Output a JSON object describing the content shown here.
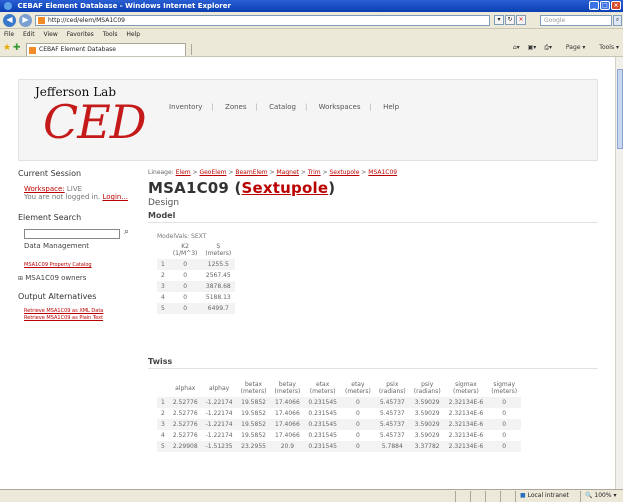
{
  "browser": {
    "title": "CEBAF Element Database - Windows Internet Explorer",
    "url": "http://ced/elem/MSA1C09",
    "search_placeholder": "Google",
    "menu": [
      "File",
      "Edit",
      "View",
      "Favorites",
      "Tools",
      "Help"
    ],
    "tab_title": "CEBAF Element Database",
    "cmd": {
      "page": "Page",
      "tools": "Tools"
    },
    "status_zone": "Local intranet",
    "zoom": "100%"
  },
  "logo": {
    "top": "Jefferson Lab",
    "main": "CED"
  },
  "nav": [
    "Inventory",
    "Zones",
    "Catalog",
    "Workspaces",
    "Help"
  ],
  "sidebar": {
    "session_heading": "Current Session",
    "workspace_label": "Workspace:",
    "workspace_value": "LIVE",
    "login_text": "You are not logged in.",
    "login_link": "Login...",
    "search_heading": "Element Search",
    "search_value": "",
    "data_mgmt": "Data Management",
    "catalog_link": "MSA1C09 Property Catalog",
    "owners": "MSA1C09 owners",
    "output_heading": "Output Alternatives",
    "xml_link": "Retrieve MSA1C09 as XML Data",
    "text_link": "Retrieve MSA1C09 as Plain Text"
  },
  "main": {
    "lineage_label": "Lineage:",
    "lineage": [
      "Elem",
      "GeoElem",
      "BeamElem",
      "Magnet",
      "Trim",
      "Sextupole",
      "MSA1C09"
    ],
    "element_name": "MSA1C09",
    "element_type": "Sextupole",
    "subtitle": "Design"
  },
  "model": {
    "heading": "Model",
    "modelvals_label": "ModelVals: SEXT",
    "columns": [
      "",
      "K2\n(1/M^3)",
      "S\n(meters)"
    ],
    "rows": [
      [
        "1",
        "0",
        "1255.5"
      ],
      [
        "2",
        "0",
        "2567.45"
      ],
      [
        "3",
        "0",
        "3878.68"
      ],
      [
        "4",
        "0",
        "5188.13"
      ],
      [
        "5",
        "0",
        "6499.7"
      ]
    ]
  },
  "twiss": {
    "heading": "Twiss",
    "columns": [
      "",
      "alphax",
      "alphay",
      "betax\n(meters)",
      "betay\n(meters)",
      "etax\n(meters)",
      "etay\n(meters)",
      "psix\n(radians)",
      "psiy\n(radians)",
      "sigmax\n(meters)",
      "sigmay\n(meters)"
    ],
    "rows": [
      [
        "1",
        "2.52776",
        "-1.22174",
        "19.5852",
        "17.4066",
        "0.231545",
        "0",
        "5.45737",
        "3.59029",
        "2.32134E-6",
        "0"
      ],
      [
        "2",
        "2.52776",
        "-1.22174",
        "19.5852",
        "17.4066",
        "0.231545",
        "0",
        "5.45737",
        "3.59029",
        "2.32134E-6",
        "0"
      ],
      [
        "3",
        "2.52776",
        "-1.22174",
        "19.5852",
        "17.4066",
        "0.231545",
        "0",
        "5.45737",
        "3.59029",
        "2.32134E-6",
        "0"
      ],
      [
        "4",
        "2.52776",
        "-1.22174",
        "19.5852",
        "17.4066",
        "0.231545",
        "0",
        "5.45737",
        "3.59029",
        "2.32134E-6",
        "0"
      ],
      [
        "5",
        "2.29908",
        "-1.51235",
        "23.2955",
        "20.9",
        "0.231545",
        "0",
        "5.7884",
        "3.37782",
        "2.32134E-6",
        "0"
      ]
    ]
  }
}
